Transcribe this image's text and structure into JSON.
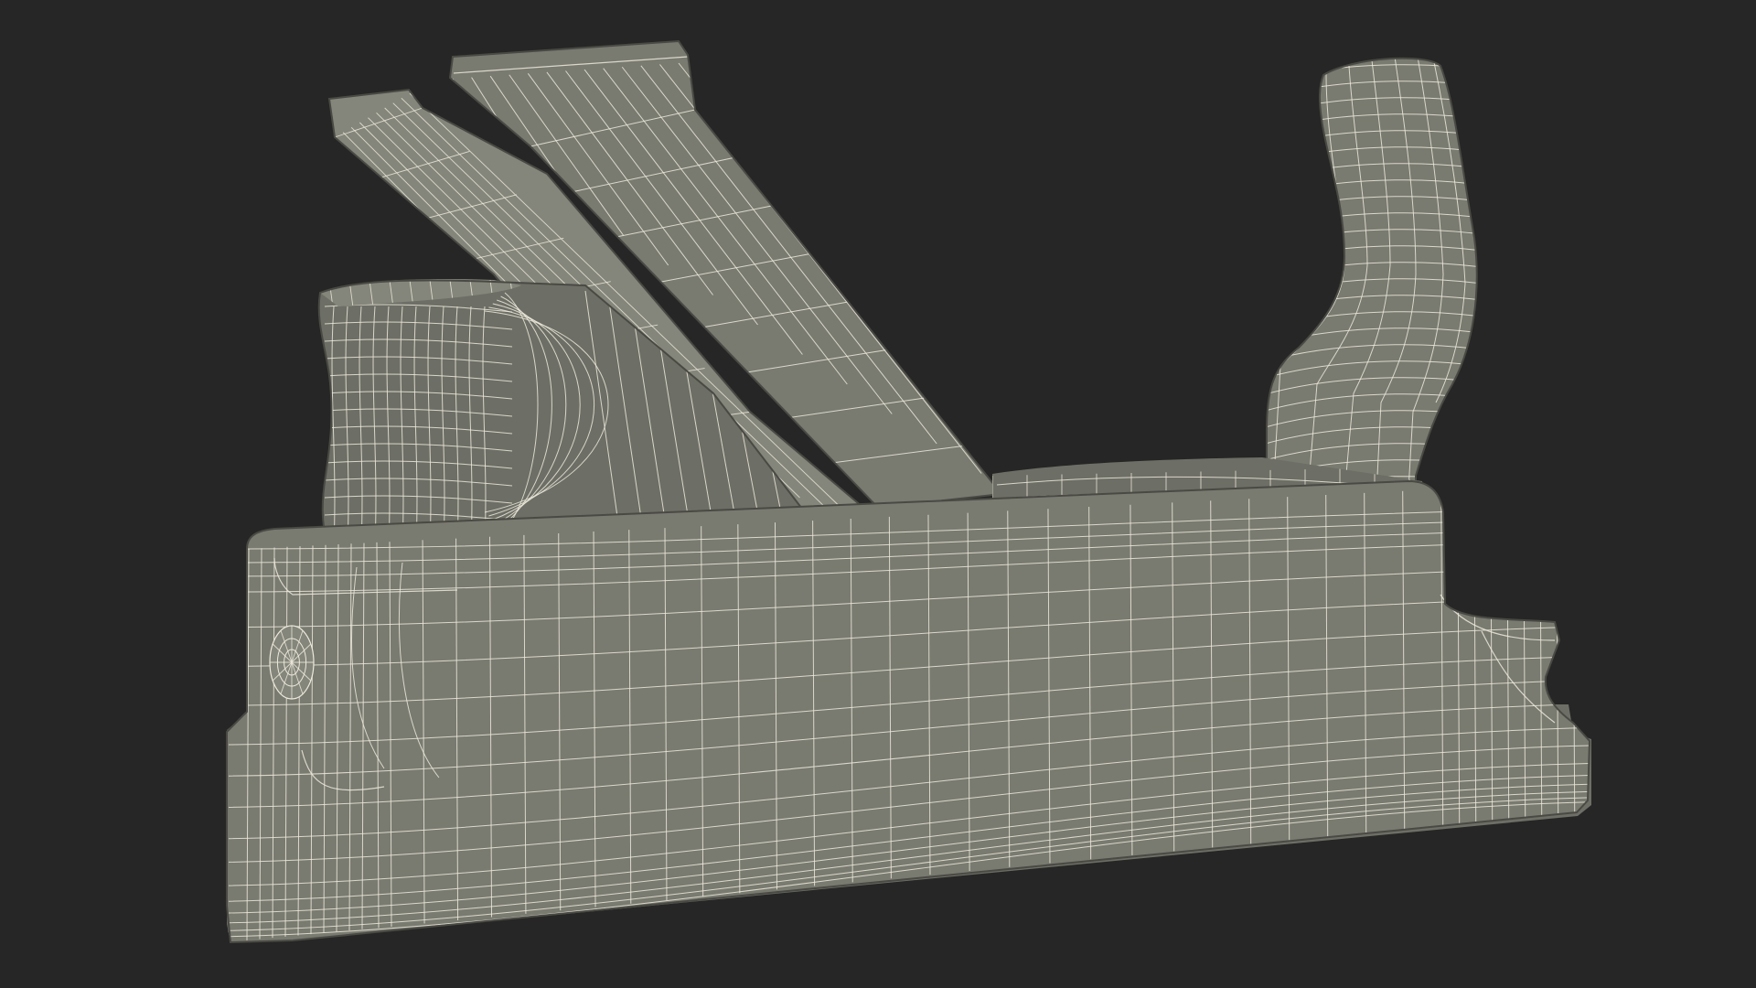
{
  "scene": {
    "subject": "wireframe-3d-model",
    "colors": {
      "background": "#262626",
      "surface": "#797a70",
      "surface_shade": "#6d6e65",
      "surface_light": "#85867b",
      "wire": "#ece9dc",
      "outline": "#4a4a44"
    }
  }
}
